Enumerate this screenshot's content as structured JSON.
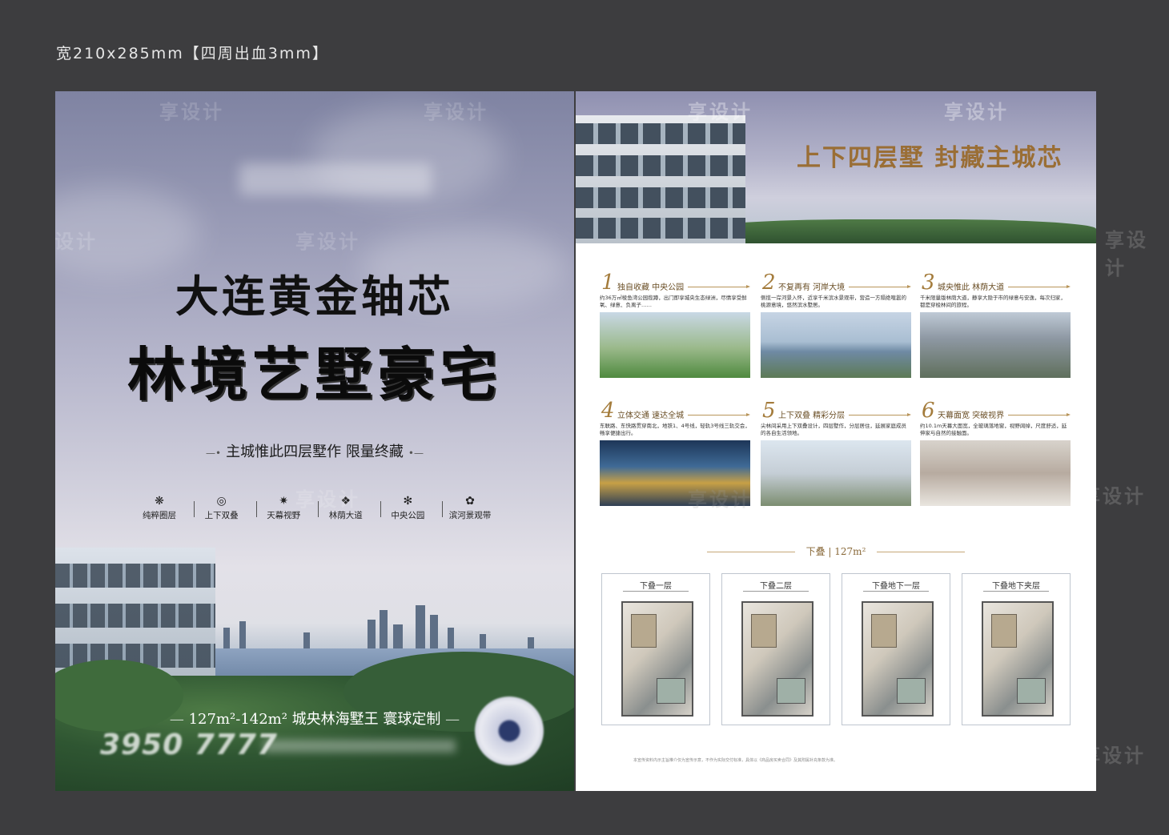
{
  "spec": "宽210x285mm【四周出血3mm】",
  "left": {
    "title_line1": "大连黄金轴芯",
    "title_line2": "林境艺墅豪宅",
    "subtitle": "主城惟此四层墅作 限量终藏",
    "features": [
      {
        "icon": "flower-icon",
        "glyph": "❋",
        "label": "纯粹圈层"
      },
      {
        "icon": "ring-icon",
        "glyph": "◎",
        "label": "上下双叠"
      },
      {
        "icon": "star-icon",
        "glyph": "✷",
        "label": "天幕视野"
      },
      {
        "icon": "tree-icon",
        "glyph": "❖",
        "label": "林荫大道"
      },
      {
        "icon": "hexagon-icon",
        "glyph": "✻",
        "label": "中央公园"
      },
      {
        "icon": "wave-icon",
        "glyph": "✿",
        "label": "滨河景观带"
      }
    ],
    "bottom_line": "127m²-142m²  城央林海墅王  寰球定制",
    "phone": "3950 7777"
  },
  "right": {
    "headline": "上下四层墅  封藏主城芯",
    "cards": [
      {
        "num": "1",
        "head": "独自收藏 中央公园",
        "body": "约36万㎡棱鱼湾公园揽蹲，出门即享城央生态绿洲，尽情享受鲜氧、绿意、负离子……"
      },
      {
        "num": "2",
        "head": "不复再有 河岸大境",
        "body": "侧揽一岸河景入怀，近享千米滨水景观带，营造一方隔绝喧嚣的桃源意境，悠然滨水墅居。"
      },
      {
        "num": "3",
        "head": "城央惟此 林荫大道",
        "body": "千米限量版林荫大道，静享大隐于市的绿意与安逸，每次归家，都是穿梭林间的旅程。"
      },
      {
        "num": "4",
        "head": "立体交通 速达全城",
        "body": "东联路、东快路贯穿南北，地铁1、4号线，轻轨3号线三轨交会，畅享便捷出行。"
      },
      {
        "num": "5",
        "head": "上下双叠 精彩分层",
        "body": "尖林间采用上下双叠设计，四层墅作，分层居住，延展家庭成员的各自生活领地。"
      },
      {
        "num": "6",
        "head": "天幕面宽 突破视界",
        "body": "约10.1m天幕大面宽，全玻璃落地窗，视野阔绰，尺度舒适，延伸家与自然的接触面。"
      }
    ],
    "plan_section": "下叠 | 127m²",
    "plans": [
      "下叠一层",
      "下叠二层",
      "下叠地下一层",
      "下叠地下夹层"
    ],
    "footnote": "本宣传资料内示主旨推介仅为宣传示意，不作为实际交付标准，具体以《商品房买卖合同》及其附属补充条款为准。"
  }
}
